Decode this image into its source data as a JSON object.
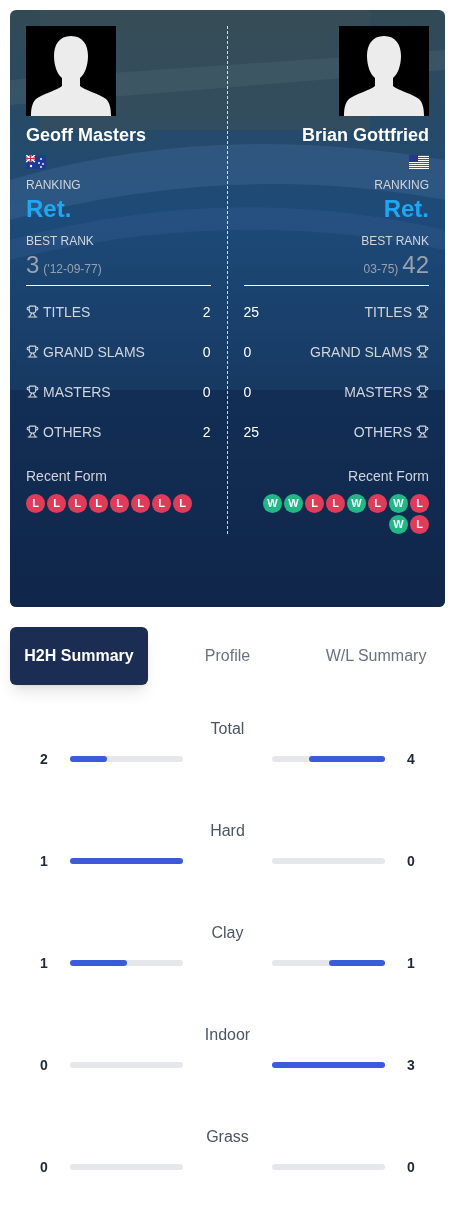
{
  "players": [
    {
      "name": "Geoff Masters",
      "flag": {
        "kind": "au"
      },
      "ranking_label": "RANKING",
      "ranking": "Ret.",
      "best_rank_label": "BEST RANK",
      "best_rank": "3",
      "best_rank_date": "('12-09-77)",
      "titles_label": "TITLES",
      "titles": "2",
      "stats": [
        {
          "label": "GRAND SLAMS",
          "value": "0"
        },
        {
          "label": "MASTERS",
          "value": "0"
        },
        {
          "label": "OTHERS",
          "value": "2"
        }
      ],
      "form_label": "Recent Form",
      "form": [
        {
          "kind": "loss",
          "label": "L"
        },
        {
          "kind": "loss",
          "label": "L"
        },
        {
          "kind": "loss",
          "label": "L"
        },
        {
          "kind": "loss",
          "label": "L"
        },
        {
          "kind": "loss",
          "label": "L"
        },
        {
          "kind": "loss",
          "label": "L"
        },
        {
          "kind": "loss",
          "label": "L"
        },
        {
          "kind": "loss",
          "label": "L"
        }
      ]
    },
    {
      "name": "Brian Gottfried",
      "flag": {
        "kind": "us"
      },
      "ranking_label": "RANKING",
      "ranking": "Ret.",
      "best_rank_label": "BEST RANK",
      "best_rank": "42",
      "best_rank_date": "03-75)",
      "titles_label": "TITLES",
      "titles": "25",
      "stats": [
        {
          "label": "GRAND SLAMS",
          "value": "0"
        },
        {
          "label": "MASTERS",
          "value": "0"
        },
        {
          "label": "OTHERS",
          "value": "25"
        }
      ],
      "form_label": "Recent Form",
      "form": [
        {
          "kind": "win",
          "label": "W"
        },
        {
          "kind": "win",
          "label": "W"
        },
        {
          "kind": "loss",
          "label": "L"
        },
        {
          "kind": "loss",
          "label": "L"
        },
        {
          "kind": "win",
          "label": "W"
        },
        {
          "kind": "loss",
          "label": "L"
        },
        {
          "kind": "win",
          "label": "W"
        },
        {
          "kind": "loss",
          "label": "L"
        },
        {
          "kind": "win",
          "label": "W"
        },
        {
          "kind": "loss",
          "label": "L"
        }
      ]
    }
  ],
  "tabs": [
    {
      "label": "H2H Summary",
      "selected": true
    },
    {
      "label": "Profile",
      "selected": false
    },
    {
      "label": "W/L Summary",
      "selected": false
    }
  ],
  "surfaces": [
    {
      "label": "Total",
      "sides": [
        {
          "value": "2",
          "level": 0.33
        },
        {
          "value": "4",
          "level": 0.67
        }
      ]
    },
    {
      "label": "Hard",
      "sides": [
        {
          "value": "1",
          "level": 1
        },
        {
          "value": "0",
          "level": 0
        }
      ]
    },
    {
      "label": "Clay",
      "sides": [
        {
          "value": "1",
          "level": 0.5
        },
        {
          "value": "1",
          "level": 0.5
        }
      ]
    },
    {
      "label": "Indoor",
      "sides": [
        {
          "value": "0",
          "level": 0
        },
        {
          "value": "3",
          "level": 1
        }
      ]
    },
    {
      "label": "Grass",
      "sides": [
        {
          "value": "0",
          "level": 0
        },
        {
          "value": "0",
          "level": 0
        }
      ]
    }
  ]
}
